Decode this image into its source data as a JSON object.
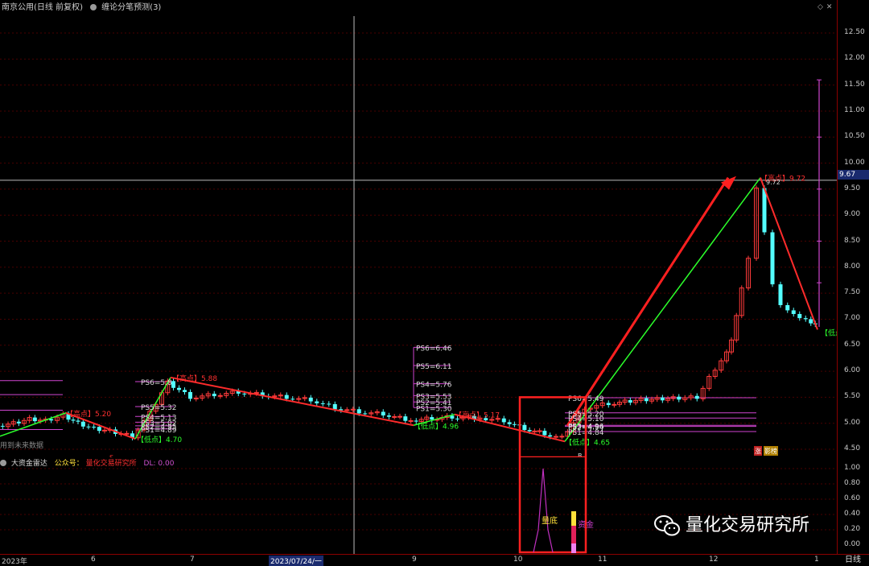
{
  "title_bar": {
    "stock_name": "南京公用(日线 前复权)",
    "indicator_name": "缠论分笔预测(3)",
    "icons": [
      "diamond-icon",
      "close-icon"
    ]
  },
  "price_axis": {
    "labels": [
      "12.50",
      "12.00",
      "11.50",
      "11.00",
      "10.50",
      "10.00",
      "9.67",
      "9.50",
      "9.00",
      "8.50",
      "8.00",
      "7.50",
      "7.00",
      "6.50",
      "6.00",
      "5.50",
      "5.00",
      "4.50"
    ],
    "cursor_value": "9.67"
  },
  "sub_axis": {
    "labels": [
      "1.00",
      "0.80",
      "0.60",
      "0.40",
      "0.20",
      "0.00"
    ]
  },
  "subchart": {
    "title": "大资金雷达",
    "items": [
      "公众号：",
      "量化交易研究所",
      "DL: 0.00"
    ],
    "label_liangdi": "量底",
    "label_zijin": "资金"
  },
  "annotations": {
    "ps_left": [
      "PS6=5.8",
      "PS5=5.32",
      "PS4=5.13",
      "PS3=5.02",
      "PS2=4.95",
      "PS1=4.89"
    ],
    "ps_mid": [
      "PS6=6.46",
      "PS5=6.11",
      "PS4=5.76",
      "PS3=5.53",
      "PS2=5.41",
      "PS1=5.30"
    ],
    "ps_right": [
      "PS6=5.49",
      "PS5=5.20",
      "PS4=5.10",
      "PS3=4.96",
      "PS2=4.94",
      "PS1=4.84"
    ],
    "high_points": [
      "【高点】5.20",
      "【高点】5.88",
      "【高点】5.17",
      "【高点】9.72"
    ],
    "low_points": [
      "【低点】4.70",
      "【低点】4.96",
      "【低点】4.65",
      "【低点"
    ],
    "peak_label": "9.72",
    "badge_zhang": "涨",
    "badge_ying": "影榜",
    "future_note": "用到未来数据",
    "marker_s": "S",
    "marker_b": "B"
  },
  "time_axis": {
    "labels": [
      "2023年",
      "6",
      "7",
      "2023/07/24/一",
      "9",
      "10",
      "11",
      "12",
      "1"
    ],
    "period": "日线"
  },
  "watermark": {
    "text": "量化交易研究所"
  },
  "colors": {
    "up": "#ff3b3b",
    "down": "#54ffff",
    "stroke_high_low": "#ff2b2b",
    "stroke_green": "#2bff2b",
    "ps": "#cf45cf",
    "highlight_box": "#ff2020"
  }
}
